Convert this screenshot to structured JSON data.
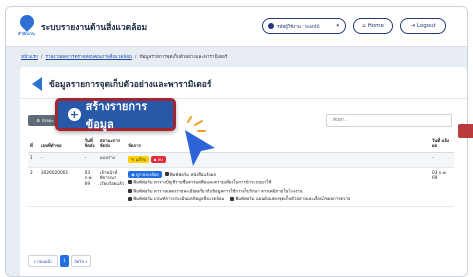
{
  "header": {
    "app_title": "ระบบรายงานด้านสิ่งแวดล้อม",
    "user_label": "รหัสผู้ใช้งาน : test46",
    "home_label": "Home",
    "logout_label": "Logout",
    "logo_text": "สำนักงาน"
  },
  "breadcrumb": {
    "items": [
      "หน้าแรก",
      "รายงานผลการตรวจสอบคุณภาพสิ่งแวดล้อม",
      "ข้อมูลรายการจุดเก็บตัวอย่างและพารามิเตอร์"
    ]
  },
  "page": {
    "title": "ข้อมูลรายการจุดเก็บตัวอย่างและพารามิเตอร์"
  },
  "toolbar": {
    "recycle_label": "ถังขยะ",
    "search_placeholder": "ค้นหา..",
    "create_label": "สร้างรายการข้อมูล"
  },
  "table": {
    "headers": {
      "no": "ที่",
      "doc": "เลขที่คำขอ",
      "side": "วันที่ จัดส่ง",
      "plan": "สถานะการจัดส่ง",
      "action": "จัดการ",
      "date": "วันที่ แจ้ง ผล"
    },
    "rows": [
      {
        "no": "1",
        "doc": "-",
        "side": "-",
        "plan": "แบบร่าง",
        "edit_label": "แก้ไข",
        "delete_label": "ลบ",
        "date": "-"
      },
      {
        "no": "2",
        "doc": "3026020001",
        "side": "03 ก.พ. 69",
        "plan": "เจ้าหน้าที่พิจารณา เรียบร้อยแล้ว",
        "view_label": "ดูรายละเอียด",
        "pdf_1": "พิมพ์ฟอร์ม หนังสือแจ้งผล",
        "pdf_2": "พิมพ์ฟอร์ม ตารางบัญชีรายชื่อสารมลพิษและความเสี่ยงในการนำระบบมาใช้",
        "pdf_3": "พิมพ์ฟอร์ม ตารางแสดงรายละเอียดเกี่ยวกับข้อมูลการใช้การเก็บรักษา สารเคมีภายในโรงงาน",
        "pdf_4": "พิมพ์ฟอร์ม เกณฑ์การประเมินผลข้อมูลสิ่งแวดล้อม",
        "pdf_5": "พิมพ์ฟอร์ม แผนผังแสดงจุดเก็บตัวอย่างและเงื่อนไขผลการตรวจ",
        "date": "03 ก.พ. 69"
      }
    ]
  },
  "pagination": {
    "prev_label": "« ก่อนหน้า",
    "current": "1",
    "next_label": "ถัดไป »"
  },
  "colors": {
    "primary": "#2858a8",
    "highlight_border": "#a02530",
    "accent_blue": "#1f6fe0",
    "edit_yellow": "#ffd200",
    "delete_red": "#e22d3b"
  },
  "icons": {
    "user": "user-icon",
    "home": "home-icon",
    "logout": "logout-icon",
    "back": "back-arrow-icon",
    "recycle": "recycle-icon",
    "plus": "plus-circle-icon",
    "pdf": "printer-icon",
    "cursor": "pointer-cursor-icon"
  }
}
